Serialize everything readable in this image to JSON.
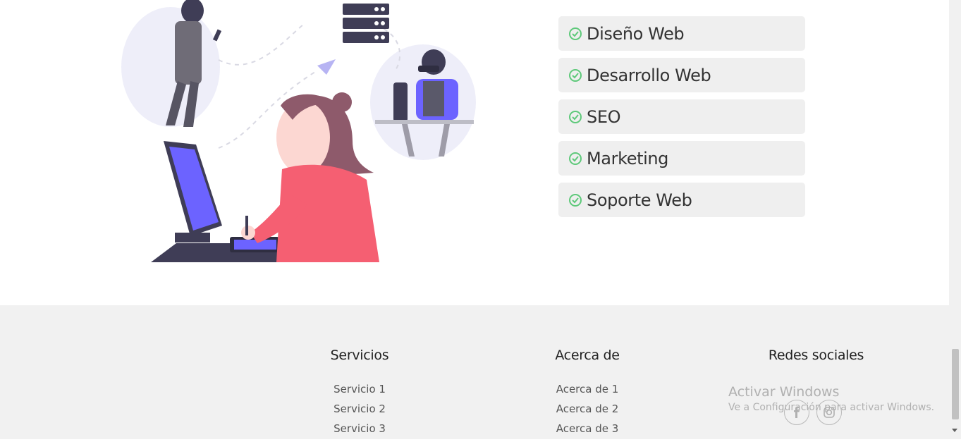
{
  "services": [
    {
      "label": "Diseño Web"
    },
    {
      "label": "Desarrollo Web"
    },
    {
      "label": "SEO"
    },
    {
      "label": "Marketing"
    },
    {
      "label": "Soporte Web"
    }
  ],
  "footer": {
    "servicios": {
      "title": "Servicios",
      "links": [
        "Servicio 1",
        "Servicio 2",
        "Servicio 3"
      ]
    },
    "acerca": {
      "title": "Acerca de",
      "links": [
        "Acerca de 1",
        "Acerca de 2",
        "Acerca de 3"
      ]
    },
    "redes": {
      "title": "Redes sociales",
      "icons": [
        "facebook-icon",
        "instagram-icon"
      ]
    }
  },
  "watermark": {
    "title": "Activar Windows",
    "subtitle": "Ve a Configuración para activar Windows."
  },
  "colors": {
    "accent": "#5ec97a",
    "purple": "#6c63ff",
    "dark": "#3f3d56",
    "pink": "#f55f72",
    "hair": "#8e5a6b"
  }
}
